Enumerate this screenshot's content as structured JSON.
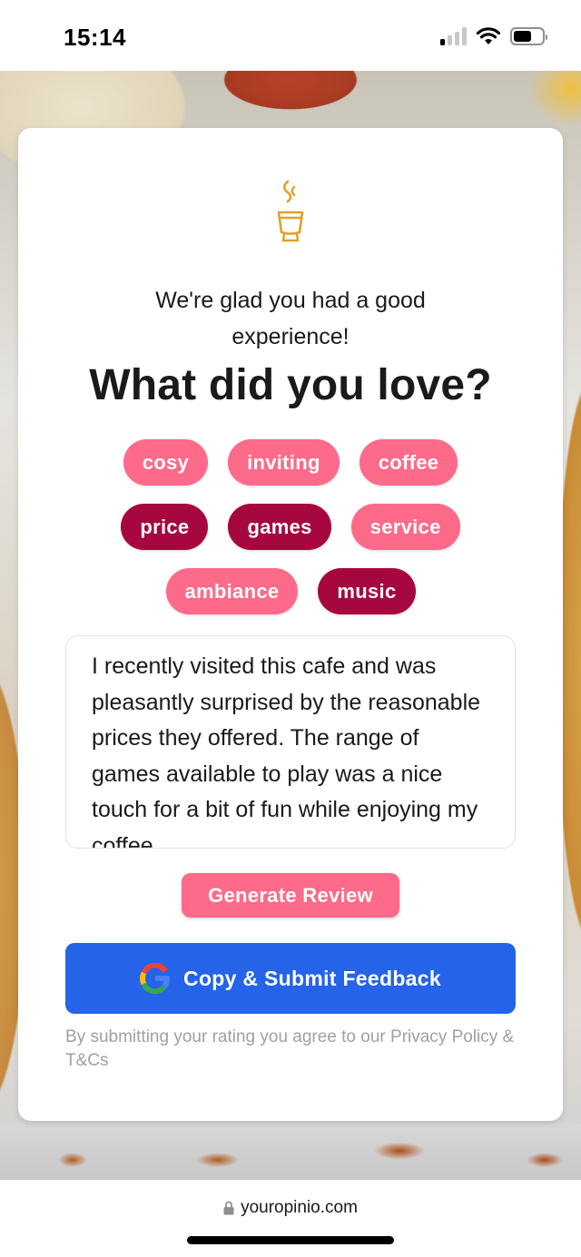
{
  "status_bar": {
    "time": "15:14",
    "icons": [
      "signal-icon",
      "wifi-icon",
      "battery-icon"
    ]
  },
  "card": {
    "logo_icon": "coffee-cup-icon",
    "subtitle": "We're glad you had a good experience!",
    "heading": "What did you love?",
    "tags": [
      [
        {
          "label": "cosy",
          "selected": false
        },
        {
          "label": "inviting",
          "selected": false
        },
        {
          "label": "coffee",
          "selected": false
        }
      ],
      [
        {
          "label": "price",
          "selected": true
        },
        {
          "label": "games",
          "selected": true
        },
        {
          "label": "service",
          "selected": false
        }
      ],
      [
        {
          "label": "ambiance",
          "selected": false
        },
        {
          "label": "music",
          "selected": true
        }
      ]
    ],
    "review_text": "I recently visited this cafe and was pleasantly surprised by the reasonable prices they offered. The range of games available to play was a nice touch for a bit of fun while enjoying my coffee.",
    "generate_label": "Generate Review",
    "submit_label": "Copy & Submit Feedback",
    "submit_icon": "google-icon",
    "legal_text": "By submitting your rating you agree to our Privacy Policy & T&Cs"
  },
  "colors": {
    "tag_unselected": "#fe6a8a",
    "tag_selected": "#a6073f",
    "submit_button": "#2563e8",
    "logo": "#e0a02a"
  },
  "browser": {
    "url": "youropinio.com"
  }
}
